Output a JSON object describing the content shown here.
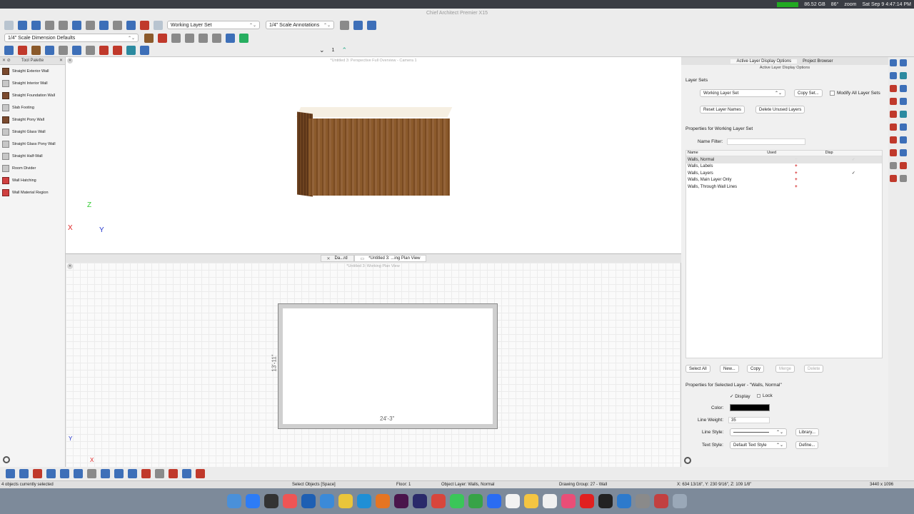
{
  "menubar": {
    "storage": "86.52 GB",
    "temp": "86°",
    "app_zoom": "zoom",
    "datetime": "Sat Sep 9  4:47:14 PM"
  },
  "window": {
    "title": "Chief Architect Premier X15"
  },
  "toolbar": {
    "layer_set": "Working Layer Set",
    "annotation_set": "1/4\" Scale Annotations",
    "dimension_defaults": "1/4\" Scale Dimension Defaults",
    "floor_number": "1"
  },
  "palette": {
    "title": "Tool Palette",
    "items": [
      "Straight Exterior Wall",
      "Straight Interior Wall",
      "Straight Foundation Wall",
      "Slab Footing",
      "Straight Pony Wall",
      "Straight Glass Wall",
      "Straight Glass Pony Wall",
      "Straight Half-Wall",
      "Room Divider",
      "Wall Hatching",
      "Wall Material Region"
    ]
  },
  "view3d": {
    "title": "*Untitled 3:  Perspective Full Overview - Camera 1",
    "axis_z": "Z",
    "axis_x": "X",
    "axis_y": "Y"
  },
  "tabs": [
    {
      "label": "Da...rd"
    },
    {
      "label": "*Untitled 3:  ...ing Plan View"
    }
  ],
  "plan": {
    "title": "*Untitled 3:  Working Plan View",
    "dim_width": "24'-3\"",
    "dim_height": "13'-11\"",
    "axis_y": "Y",
    "axis_x": "X"
  },
  "rpanel": {
    "tab_active": "Active Layer Display Options",
    "tab_browser": "Project Browser",
    "subtitle": "Active Layer Display Options",
    "layer_sets_label": "Layer Sets",
    "layer_set_value": "Working Layer Set",
    "copy_set": "Copy Set...",
    "modify_all": "Modify All Layer Sets",
    "reset_names": "Reset Layer Names",
    "delete_unused": "Delete Unused Layers",
    "properties_for": "Properties for  Working Layer Set",
    "name_filter": "Name Filter:",
    "columns": {
      "name": "Name",
      "used": "Used",
      "disp": "Disp"
    },
    "rows": [
      {
        "name": "Walls, Normal",
        "used": "+",
        "disp": "✓"
      },
      {
        "name": "Walls, Labels",
        "used": "+",
        "disp": ""
      },
      {
        "name": "Walls, Layers",
        "used": "+",
        "disp": "✓"
      },
      {
        "name": "Walls, Main Layer Only",
        "used": "+",
        "disp": ""
      },
      {
        "name": "Walls, Through Wall Lines",
        "used": "+",
        "disp": ""
      }
    ],
    "buttons": {
      "select_all": "Select All",
      "new": "New...",
      "copy": "Copy",
      "merge": "Merge",
      "delete": "Delete"
    },
    "selected_title": "Properties for Selected Layer - \"Walls, Normal\"",
    "display": "Display",
    "lock": "Lock",
    "color_label": "Color:",
    "color_value": "#000000",
    "line_weight_label": "Line Weight:",
    "line_weight": "35",
    "line_style_label": "Line Style:",
    "library": "Library...",
    "text_style_label": "Text Style:",
    "text_style": "Default Text Style",
    "define": "Define..."
  },
  "status": {
    "selected": "4 objects currently selected",
    "mode": "Select Objects [Space]",
    "floor": "Floor: 1",
    "object_layer": "Object Layer: Walls, Normal",
    "drawing_group": "Drawing Group: 27 - Wall",
    "coords": "X: 634 13/16\", Y: 230 9/16\", Z: 109 1/8\"",
    "resolution": "3440 x 1096"
  }
}
